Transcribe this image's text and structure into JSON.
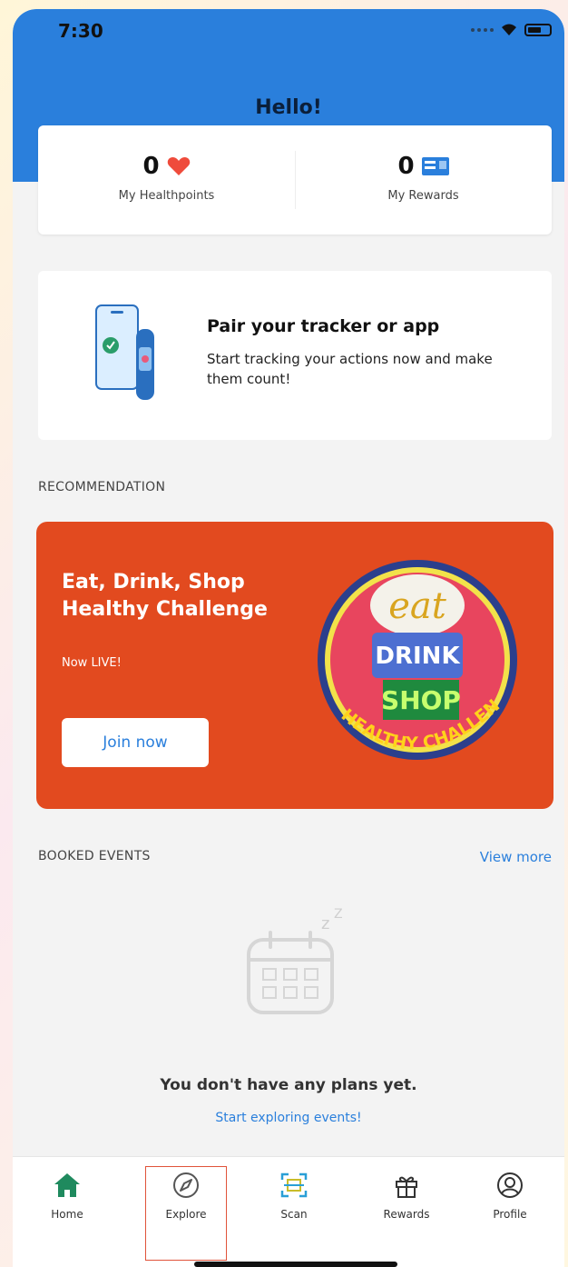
{
  "status_bar": {
    "time": "7:30"
  },
  "header": {
    "greeting": "Hello!"
  },
  "points": {
    "healthpoints": {
      "value": "0",
      "label": "My Healthpoints",
      "icon": "heart-icon"
    },
    "rewards": {
      "value": "0",
      "label": "My Rewards",
      "icon": "rewards-card-icon"
    }
  },
  "pair_card": {
    "title": "Pair your tracker or app",
    "description": "Start tracking your actions now and make them count!"
  },
  "recommendation": {
    "section_label": "RECOMMENDATION",
    "promo": {
      "title": "Eat, Drink, Shop Healthy Challenge",
      "subtitle": "Now LIVE!",
      "button": "Join now",
      "badge_text": {
        "eat": "eat",
        "drink": "DRINK",
        "shop": "SHOP",
        "ribbon": "HEALTHY CHALLENGE"
      }
    }
  },
  "booked_events": {
    "section_label": "BOOKED EVENTS",
    "view_more": "View more",
    "empty_title": "You don't have any plans yet.",
    "empty_link": "Start exploring events!"
  },
  "bottom_nav": [
    {
      "label": "Home",
      "icon": "home-icon"
    },
    {
      "label": "Explore",
      "icon": "compass-icon"
    },
    {
      "label": "Scan",
      "icon": "scan-icon"
    },
    {
      "label": "Rewards",
      "icon": "gift-icon"
    },
    {
      "label": "Profile",
      "icon": "profile-icon"
    }
  ],
  "colors": {
    "header_blue": "#2a7fdc",
    "promo_orange": "#e24a1f",
    "heart_red": "#ef4b3b",
    "home_green": "#1f8a5e"
  }
}
